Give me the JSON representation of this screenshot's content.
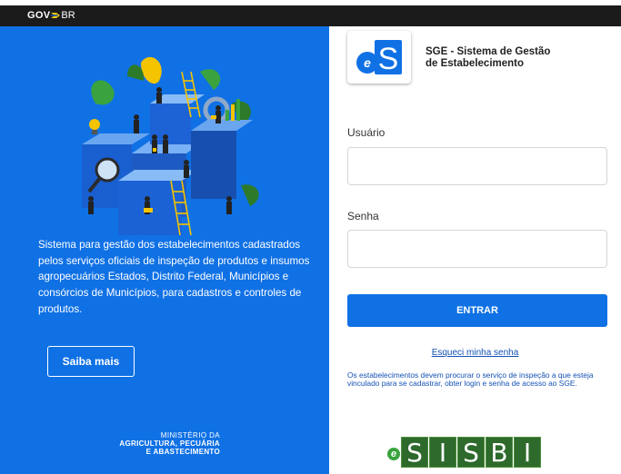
{
  "gov_bar": {
    "gov": "GOV",
    "br": "BR"
  },
  "left": {
    "description": "Sistema para gestão dos estabelecimentos cadastrados pelos serviços oficiais de inspeção de produtos e insumos agropecuários Estados, Distrito Federal, Municípios e consórcios de Municípios, para cadastros e controles de produtos.",
    "saiba_mais": "Saiba mais",
    "ministerio": [
      "MINISTÉRIO DA",
      "AGRICULTURA, PECUÁRIA",
      "E ABASTECIMENTO"
    ]
  },
  "app": {
    "logo_text": "S",
    "logo_e": "e",
    "name_line1": "SGE - Sistema de Gestão",
    "name_line2": "de Estabelecimento"
  },
  "form": {
    "usuario_label": "Usuário",
    "usuario_value": "",
    "usuario_placeholder": "",
    "senha_label": "Senha",
    "senha_value": "",
    "senha_placeholder": "",
    "entrar": "ENTRAR",
    "esqueci": "Esqueci minha senha",
    "info": "Os estabelecimentos devem procurar o serviço de inspeção a que esteja vinculado para se cadastrar, obter login e senha de acesso ao SGE."
  },
  "sisbi": {
    "e": "e",
    "letters": [
      "S",
      "I",
      "S",
      "B",
      "I"
    ]
  },
  "colors": {
    "primary": "#1071e5",
    "govbar": "#1b1b1b",
    "link": "#1351b4",
    "sisbi_green": "#2d6a2c"
  }
}
